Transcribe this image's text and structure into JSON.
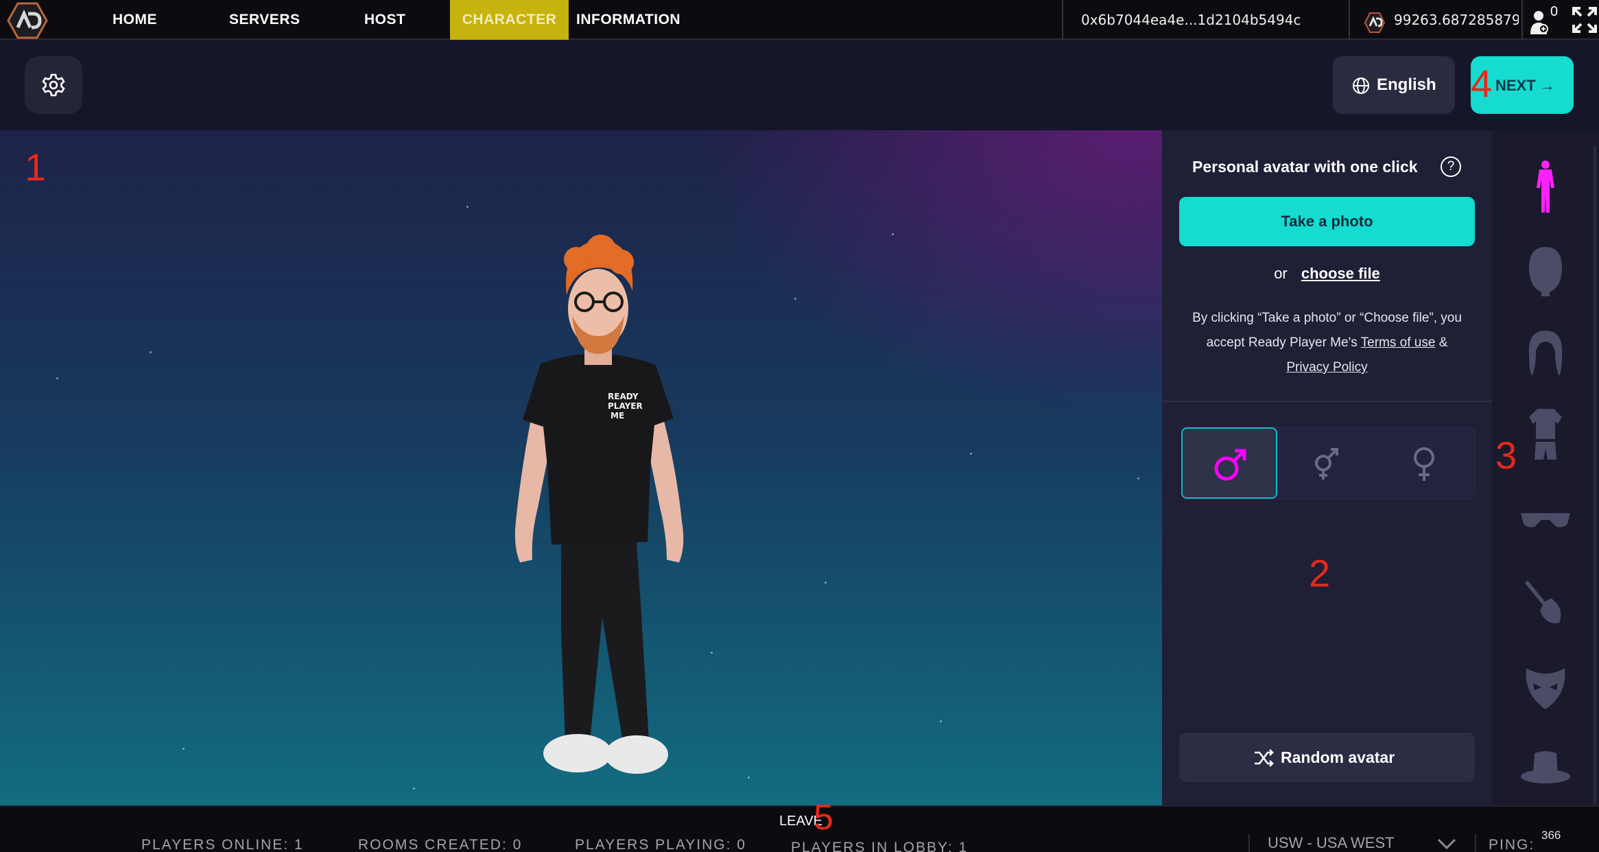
{
  "nav": {
    "items": [
      {
        "label": "HOME"
      },
      {
        "label": "SERVERS"
      },
      {
        "label": "HOST"
      },
      {
        "label": "CHARACTER"
      },
      {
        "label": "INFORMATION"
      }
    ],
    "active": "CHARACTER",
    "wallet_address": "0x6b7044ea4e...1d2104b5494c",
    "balance": "99263.6872858790",
    "user_count": "0",
    "accent_color": "#c7b30d"
  },
  "header": {
    "language_label": "English",
    "next_label": "NEXT →"
  },
  "panel": {
    "title": "Personal avatar with one click",
    "help_symbol": "?",
    "take_photo_label": "Take a photo",
    "or_text": "or",
    "choose_file_label": "choose file",
    "legal_prefix": "By clicking “Take a photo” or “Choose file”, you accept Ready Player Me's",
    "terms_label": "Terms of use",
    "legal_and": "&",
    "privacy_label": "Privacy Policy",
    "gender_options": [
      {
        "name": "male",
        "selected": true
      },
      {
        "name": "neutral",
        "selected": false
      },
      {
        "name": "female",
        "selected": false
      }
    ],
    "random_label": "Random avatar",
    "accent_color": "#15dbd1",
    "selected_color": "#ff00ff"
  },
  "categories": [
    {
      "icon": "body-icon",
      "active": true
    },
    {
      "icon": "head-icon",
      "active": false
    },
    {
      "icon": "hair-icon",
      "active": false
    },
    {
      "icon": "outfit-icon",
      "active": false
    },
    {
      "icon": "glasses-icon",
      "active": false
    },
    {
      "icon": "makeup-brush-icon",
      "active": false
    },
    {
      "icon": "mask-icon",
      "active": false
    },
    {
      "icon": "hat-icon",
      "active": false
    }
  ],
  "annotations": {
    "one": "1",
    "two": "2",
    "three": "3",
    "four": "4",
    "five": "5"
  },
  "footer": {
    "leave_label": "LEAVE",
    "players_online": "PLAYERS ONLINE: 1",
    "rooms_created": "ROOMS CREATED: 0",
    "players_playing": "PLAYERS PLAYING: 0",
    "players_in_lobby": "PLAYERS IN LOBBY: 1",
    "region": "USW - USA WEST",
    "ping_label": "PING:",
    "ping_value": "366"
  }
}
